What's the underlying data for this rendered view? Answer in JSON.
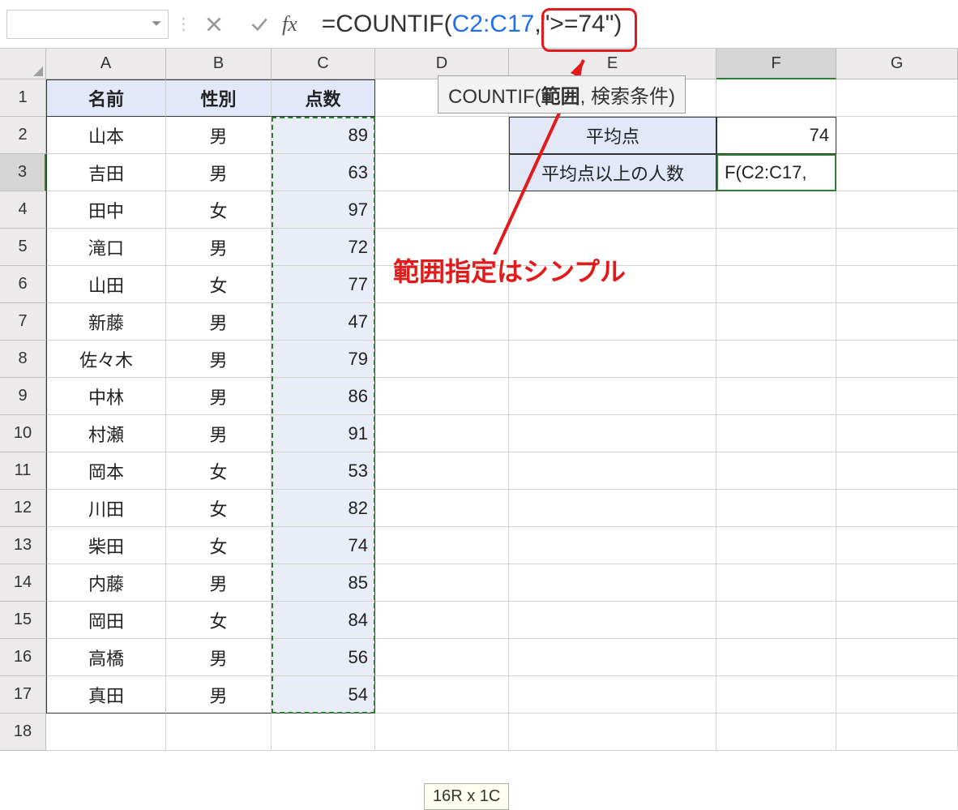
{
  "formula_bar": {
    "name_box": "",
    "cancel_icon": "cancel",
    "confirm_icon": "confirm",
    "fx_label": "fx",
    "formula_prefix": "=COUNTIF(",
    "formula_ref": "C2:C17",
    "formula_suffix": ",\">=74\")"
  },
  "tooltip": {
    "fn_name": "COUNTIF(",
    "arg1": "範囲",
    "sep": ", ",
    "arg2": "検索条件)"
  },
  "annotation_text": "範囲指定はシンプル",
  "size_indicator": "16R x 1C",
  "columns": [
    "A",
    "B",
    "C",
    "D",
    "E",
    "F",
    "G"
  ],
  "rows": [
    "1",
    "2",
    "3",
    "4",
    "5",
    "6",
    "7",
    "8",
    "9",
    "10",
    "11",
    "12",
    "13",
    "14",
    "15",
    "16",
    "17",
    "18"
  ],
  "headers": {
    "A": "名前",
    "B": "性別",
    "C": "点数"
  },
  "table": [
    {
      "name": "山本",
      "sex": "男",
      "score": "89"
    },
    {
      "name": "吉田",
      "sex": "男",
      "score": "63"
    },
    {
      "name": "田中",
      "sex": "女",
      "score": "97"
    },
    {
      "name": "滝口",
      "sex": "男",
      "score": "72"
    },
    {
      "name": "山田",
      "sex": "女",
      "score": "77"
    },
    {
      "name": "新藤",
      "sex": "男",
      "score": "47"
    },
    {
      "name": "佐々木",
      "sex": "男",
      "score": "79"
    },
    {
      "name": "中林",
      "sex": "男",
      "score": "86"
    },
    {
      "name": "村瀬",
      "sex": "男",
      "score": "91"
    },
    {
      "name": "岡本",
      "sex": "女",
      "score": "53"
    },
    {
      "name": "川田",
      "sex": "女",
      "score": "82"
    },
    {
      "name": "柴田",
      "sex": "女",
      "score": "74"
    },
    {
      "name": "内藤",
      "sex": "男",
      "score": "85"
    },
    {
      "name": "岡田",
      "sex": "女",
      "score": "84"
    },
    {
      "name": "高橋",
      "sex": "男",
      "score": "56"
    },
    {
      "name": "真田",
      "sex": "男",
      "score": "54"
    }
  ],
  "summary": {
    "row1_label": "平均点",
    "row1_value": "74",
    "row2_label": "平均点以上の人数",
    "row2_value": "F(C2:C17,"
  }
}
